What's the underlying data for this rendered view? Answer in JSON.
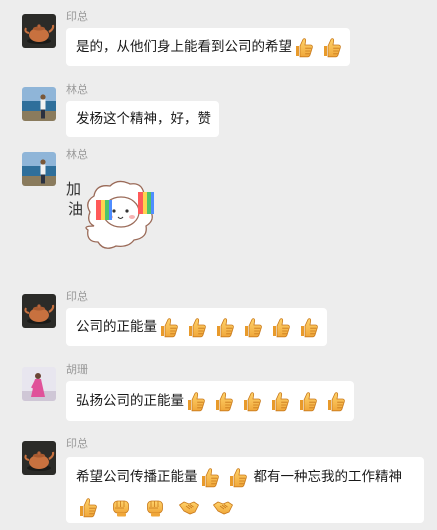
{
  "messages": [
    {
      "sender": "印总",
      "avatar": "teapot-avatar",
      "text_before": "是的，从他们身上能看到公司的希望",
      "emojis": [
        "thumbs-up",
        "thumbs-up"
      ]
    },
    {
      "sender": "林总",
      "avatar": "seaside-person-avatar",
      "text_before": "发杨这个精神，好，赞"
    },
    {
      "sender": "林总",
      "avatar": "seaside-person-avatar",
      "sticker": "sheep-cheer-sticker",
      "sticker_text": "加油"
    },
    {
      "sender": "印总",
      "avatar": "teapot-avatar",
      "text_before": "公司的正能量",
      "emojis": [
        "thumbs-up",
        "thumbs-up",
        "thumbs-up",
        "thumbs-up",
        "thumbs-up",
        "thumbs-up"
      ]
    },
    {
      "sender": "胡珊",
      "avatar": "pink-dress-avatar",
      "text_before": "弘扬公司的正能量",
      "emojis": [
        "thumbs-up",
        "thumbs-up",
        "thumbs-up",
        "thumbs-up",
        "thumbs-up",
        "thumbs-up"
      ]
    },
    {
      "sender": "印总",
      "avatar": "teapot-avatar",
      "text_before": "希望公司传播正能量",
      "text_after": "都有一种忘我的工作精神",
      "emojis_line1": [
        "thumbs-up",
        "thumbs-up"
      ],
      "emojis_line2": [
        "thumbs-up",
        "fist",
        "fist",
        "handshake",
        "handshake"
      ]
    }
  ],
  "colors": {
    "background": "#ededed",
    "bubble": "#ffffff",
    "name": "#999999",
    "text": "#191919"
  }
}
